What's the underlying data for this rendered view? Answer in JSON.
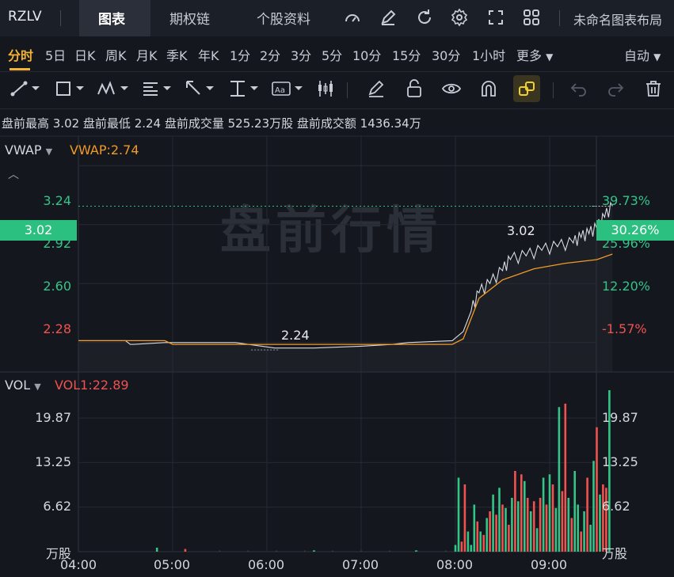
{
  "header": {
    "symbol": "RZLV",
    "tabs": [
      "图表",
      "期权链",
      "个股资料"
    ],
    "layout_name": "未命名图表布局"
  },
  "periods": {
    "items": [
      "分时",
      "5日",
      "日K",
      "周K",
      "月K",
      "季K",
      "年K",
      "1分",
      "2分",
      "3分",
      "5分",
      "10分",
      "15分",
      "30分",
      "1小时",
      "更多"
    ],
    "mode": "自动"
  },
  "stats": "盘前最高 3.02  盘前最低 2.24  盘前成交量 525.23万股  盘前成交额 1436.34万",
  "price_panel": {
    "indicator": "VWAP",
    "indicator_value": "VWAP:2.74",
    "watermark": "盘前行情",
    "current_price": "3.02",
    "current_pct": "30.26%",
    "high_label": "3.02",
    "low_label": "2.24",
    "left_ticks": [
      "3.24",
      "2.92",
      "2.60",
      "2.28"
    ],
    "right_ticks": [
      "39.73%",
      "25.96%",
      "12.20%",
      "-1.57%"
    ],
    "colors": {
      "up": "#33c488",
      "down": "#f0524f",
      "vwap": "#f29a26",
      "price_line": "#d9dce2"
    }
  },
  "volume_panel": {
    "indicator": "VOL",
    "indicator_value": "VOL1:22.89",
    "left_ticks": [
      "19.87",
      "13.25",
      "6.62",
      "万股"
    ],
    "right_ticks": [
      "19.87",
      "13.25",
      "6.62",
      "万股"
    ]
  },
  "x_ticks": [
    "04:00",
    "05:00",
    "06:00",
    "07:00",
    "08:00",
    "09:00"
  ],
  "chart_data": {
    "type": "line",
    "x_range": [
      "04:00",
      "09:10"
    ],
    "price": {
      "ylim": [
        2.12,
        3.4
      ],
      "x_minutes": [
        0,
        30,
        33,
        35,
        55,
        60,
        100,
        125,
        150,
        180,
        200,
        210,
        238,
        245,
        250,
        255,
        262,
        270,
        275,
        285,
        295,
        305,
        315,
        320,
        325,
        330,
        335,
        340
      ],
      "values": [
        2.29,
        2.29,
        2.27,
        2.27,
        2.28,
        2.28,
        2.28,
        2.25,
        2.25,
        2.26,
        2.27,
        2.28,
        2.29,
        2.34,
        2.45,
        2.55,
        2.6,
        2.67,
        2.73,
        2.75,
        2.78,
        2.8,
        2.82,
        2.85,
        2.87,
        2.9,
        2.96,
        3.02
      ],
      "vwap_x_minutes": [
        0,
        55,
        60,
        120,
        180,
        238,
        245,
        255,
        270,
        290,
        310,
        330,
        340
      ],
      "vwap_values": [
        2.29,
        2.29,
        2.27,
        2.27,
        2.27,
        2.27,
        2.3,
        2.52,
        2.62,
        2.68,
        2.71,
        2.73,
        2.76
      ]
    },
    "volume": {
      "ylim": [
        0,
        26
      ],
      "bars": [
        {
          "m": 50,
          "v": 0.6,
          "up": true
        },
        {
          "m": 68,
          "v": 0.4,
          "up": false
        },
        {
          "m": 150,
          "v": 0.2,
          "up": true
        },
        {
          "m": 215,
          "v": 0.2,
          "up": true
        },
        {
          "m": 240,
          "v": 1.0,
          "up": true
        },
        {
          "m": 242,
          "v": 11.0,
          "up": true
        },
        {
          "m": 244,
          "v": 1.5,
          "up": false
        },
        {
          "m": 246,
          "v": 10.0,
          "up": false
        },
        {
          "m": 248,
          "v": 3.0,
          "up": true
        },
        {
          "m": 250,
          "v": 1.0,
          "up": true
        },
        {
          "m": 252,
          "v": 7.0,
          "up": true
        },
        {
          "m": 254,
          "v": 4.5,
          "up": false
        },
        {
          "m": 256,
          "v": 3.0,
          "up": true
        },
        {
          "m": 258,
          "v": 2.5,
          "up": false
        },
        {
          "m": 260,
          "v": 5.0,
          "up": true
        },
        {
          "m": 262,
          "v": 6.0,
          "up": false
        },
        {
          "m": 264,
          "v": 8.5,
          "up": true
        },
        {
          "m": 266,
          "v": 5.5,
          "up": false
        },
        {
          "m": 268,
          "v": 9.5,
          "up": true
        },
        {
          "m": 270,
          "v": 7.0,
          "up": false
        },
        {
          "m": 272,
          "v": 6.5,
          "up": true
        },
        {
          "m": 274,
          "v": 4.0,
          "up": false
        },
        {
          "m": 276,
          "v": 8.0,
          "up": true
        },
        {
          "m": 278,
          "v": 12.0,
          "up": false
        },
        {
          "m": 280,
          "v": 7.5,
          "up": true
        },
        {
          "m": 282,
          "v": 11.5,
          "up": false
        },
        {
          "m": 284,
          "v": 10.5,
          "up": true
        },
        {
          "m": 286,
          "v": 8.0,
          "up": false
        },
        {
          "m": 288,
          "v": 6.0,
          "up": true
        },
        {
          "m": 290,
          "v": 7.5,
          "up": false
        },
        {
          "m": 292,
          "v": 3.5,
          "up": true
        },
        {
          "m": 294,
          "v": 8.0,
          "up": false
        },
        {
          "m": 296,
          "v": 11.0,
          "up": true
        },
        {
          "m": 298,
          "v": 7.0,
          "up": false
        },
        {
          "m": 300,
          "v": 11.5,
          "up": true
        },
        {
          "m": 302,
          "v": 10.0,
          "up": false
        },
        {
          "m": 304,
          "v": 6.5,
          "up": true
        },
        {
          "m": 306,
          "v": 21.5,
          "up": true
        },
        {
          "m": 308,
          "v": 9.0,
          "up": false
        },
        {
          "m": 310,
          "v": 22.0,
          "up": false
        },
        {
          "m": 312,
          "v": 8.0,
          "up": true
        },
        {
          "m": 314,
          "v": 5.0,
          "up": false
        },
        {
          "m": 316,
          "v": 12.0,
          "up": true
        },
        {
          "m": 318,
          "v": 7.0,
          "up": true
        },
        {
          "m": 320,
          "v": 3.0,
          "up": false
        },
        {
          "m": 322,
          "v": 6.0,
          "up": true
        },
        {
          "m": 324,
          "v": 11.0,
          "up": false
        },
        {
          "m": 326,
          "v": 4.0,
          "up": true
        },
        {
          "m": 328,
          "v": 13.5,
          "up": true
        },
        {
          "m": 330,
          "v": 18.5,
          "up": false
        },
        {
          "m": 332,
          "v": 8.5,
          "up": true
        },
        {
          "m": 334,
          "v": 10.0,
          "up": false
        },
        {
          "m": 336,
          "v": 9.5,
          "up": false
        },
        {
          "m": 338,
          "v": 24.0,
          "up": true
        }
      ]
    }
  }
}
